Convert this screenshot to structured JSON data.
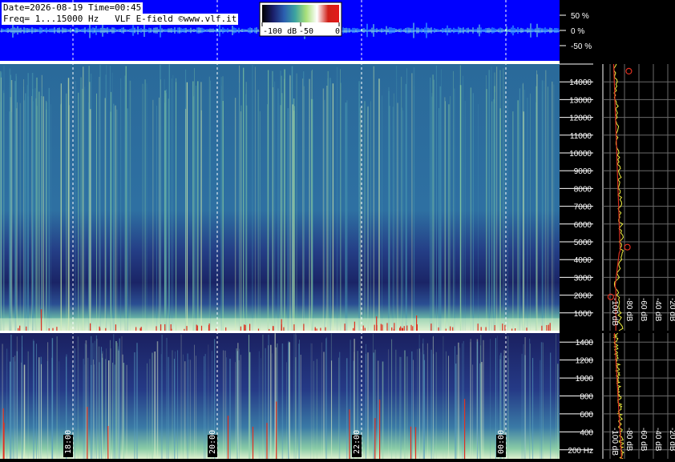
{
  "header": {
    "date_time": "Date=2026-08-19 Time=00:45",
    "freq_info": "Freq= 1...15000 Hz   VLF E-field ©www.vlf.it"
  },
  "colorbar": {
    "labels": [
      "-100 dB",
      "-50",
      "0"
    ],
    "stops": [
      "#000000",
      "#1a1f6b",
      "#2b5fb0",
      "#3ca3a0",
      "#a8e07a",
      "#ffffff",
      "#d02018",
      "#e31a1a"
    ]
  },
  "colors": {
    "waveform_bg": "#0000ff",
    "spectrogram_dark": "#1a1f5c",
    "spectrogram_mid": "#2d6aa5",
    "spectrogram_light": "#a9e3a0",
    "spectrum_yellow": "#f0f040",
    "spectrum_red": "#d83020"
  },
  "chart_data": [
    {
      "type": "line",
      "ylabel_ticks": [
        "50 %",
        "0 %",
        "-50 %"
      ],
      "y": [
        50,
        0,
        -50
      ],
      "ylim": [
        -100,
        100
      ],
      "grid": false
    },
    {
      "type": "heatmap",
      "x_ticks": [
        "18:00",
        "20:00",
        "22:00",
        "00:00"
      ],
      "y_ticks": [
        "1000",
        "2000",
        "3000",
        "4000",
        "5000",
        "6000",
        "7000",
        "8000",
        "9000",
        "10000",
        "11000",
        "12000",
        "13000",
        "14000"
      ],
      "y_values": [
        1000,
        2000,
        3000,
        4000,
        5000,
        6000,
        7000,
        8000,
        9000,
        10000,
        11000,
        12000,
        13000,
        14000
      ],
      "ylim": [
        0,
        15000
      ],
      "grid": true
    },
    {
      "type": "heatmap",
      "x_ticks": [
        "18:00",
        "20:00",
        "22:00",
        "00:00"
      ],
      "y_ticks": [
        "200 Hz",
        "400",
        "600",
        "800",
        "1000",
        "1200",
        "1400"
      ],
      "y_values": [
        200,
        400,
        600,
        800,
        1000,
        1200,
        1400
      ],
      "ylim": [
        100,
        1500
      ],
      "grid": true
    },
    {
      "type": "line",
      "x_ticks": [
        "-100 dB",
        "-80 dB",
        "-60 dB",
        "-40 dB",
        "-20 dB"
      ],
      "x_values": [
        -100,
        -80,
        -60,
        -40,
        -20
      ],
      "xlim": [
        -110,
        -10
      ],
      "grid": true
    }
  ]
}
